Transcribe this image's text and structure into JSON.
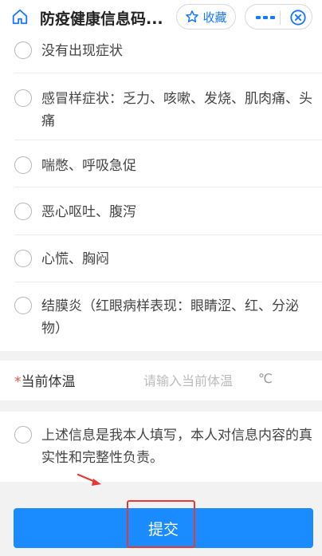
{
  "header": {
    "title": "防疫健康信息码...",
    "favorite_label": "收藏"
  },
  "symptoms": [
    {
      "label": "没有出现症状"
    },
    {
      "label": "感冒样症状：乏力、咳嗽、发烧、肌肉痛、头痛"
    },
    {
      "label": "喘憋、呼吸急促"
    },
    {
      "label": "恶心呕吐、腹泻"
    },
    {
      "label": "心慌、胸闷"
    },
    {
      "label": "结膜炎（红眼病样表现：眼睛涩、红、分泌物）"
    }
  ],
  "temperature": {
    "required_mark": "*",
    "label": "当前体温",
    "placeholder": "请输入当前体温",
    "unit": "℃"
  },
  "declaration": {
    "label": "上述信息是我本人填写，本人对信息内容的真实性和完整性负责。"
  },
  "submit": {
    "label": "提交"
  },
  "colors": {
    "accent": "#1677ff",
    "submit_bg": "#1a8cff",
    "annotation": "#e53935"
  }
}
